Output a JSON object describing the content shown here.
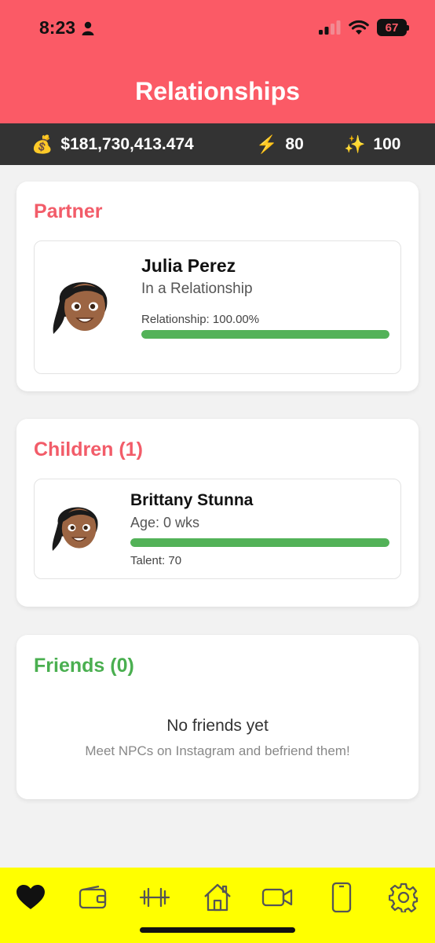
{
  "status_bar": {
    "time": "8:23",
    "battery": "67"
  },
  "header": {
    "title": "Relationships"
  },
  "stats": {
    "money_icon": "💰",
    "money": "$181,730,413.474",
    "energy_icon": "⚡",
    "energy": "80",
    "sparkle_icon": "✨",
    "sparkle": "100"
  },
  "partner": {
    "section_title": "Partner",
    "name": "Julia Perez",
    "status": "In a Relationship",
    "relationship_label": "Relationship: 100.00%",
    "relationship_level": 1.0
  },
  "children": {
    "section_title": "Children (1)",
    "items": [
      {
        "name": "Brittany Stunna",
        "age": "Age: 0 wks",
        "talent": "Talent: 70",
        "bar_level": 1.0
      }
    ]
  },
  "friends": {
    "section_title": "Friends (0)",
    "empty_title": "No friends yet",
    "empty_subtitle": "Meet NPCs on Instagram and befriend them!"
  },
  "tabs": [
    "heart-icon",
    "wallet-icon",
    "dumbbell-icon",
    "home-icon",
    "video-icon",
    "phone-icon",
    "settings-icon"
  ],
  "colors": {
    "header": "#fb5a66",
    "stats_bar": "#333333",
    "accent_red": "#f25c69",
    "accent_green": "#4aaf50",
    "progress": "#53b258",
    "tabbar": "#ffff00"
  }
}
